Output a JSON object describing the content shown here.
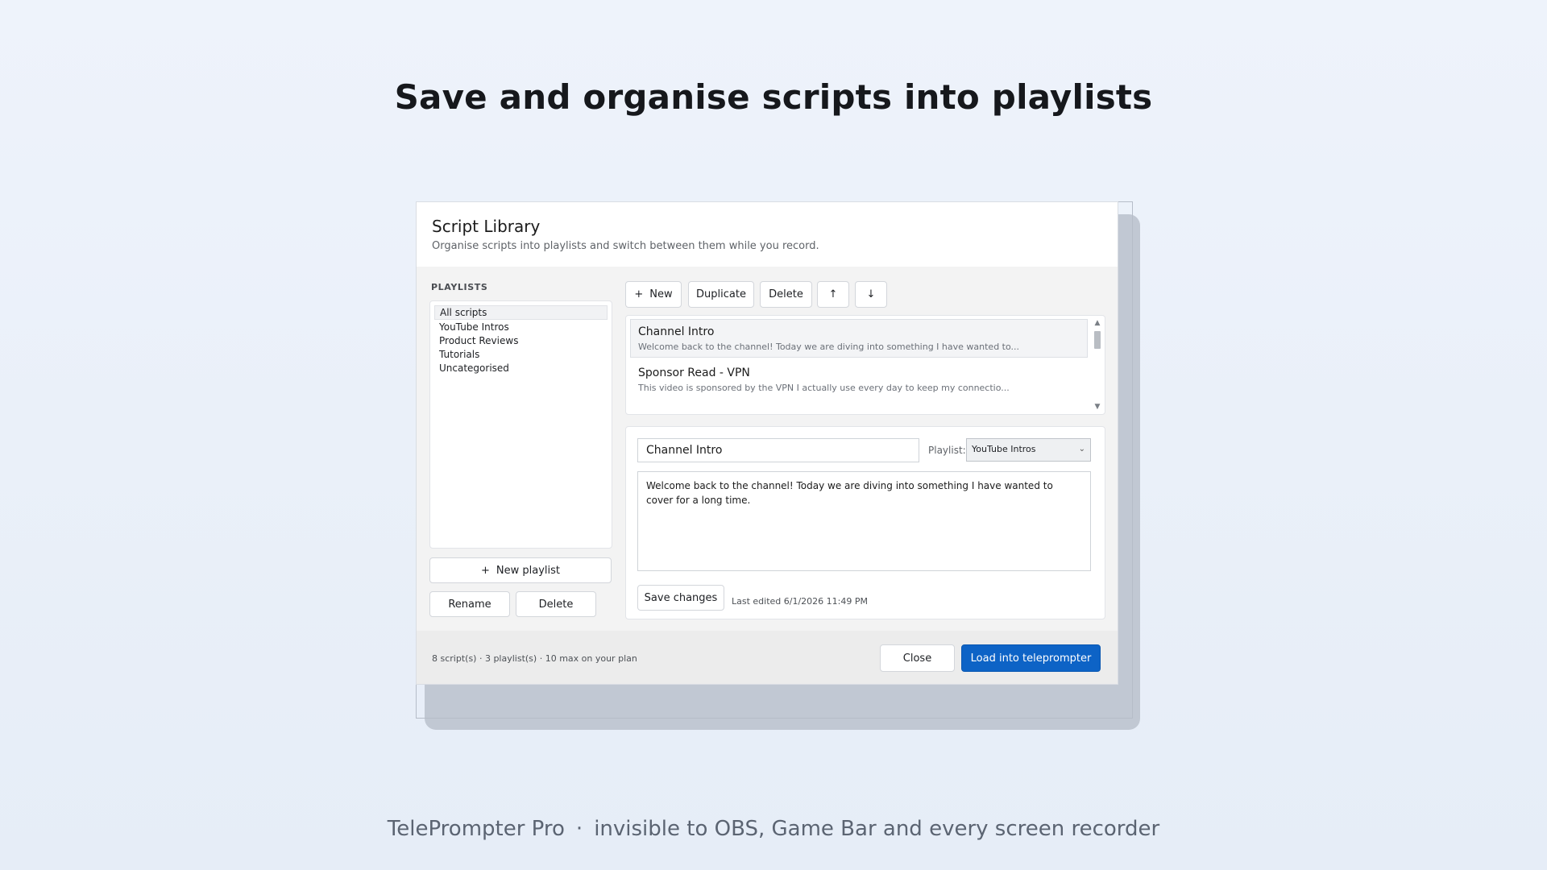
{
  "headline": "Save and organise scripts into playlists",
  "tagline": {
    "product": "TelePrompter Pro",
    "separator": "·",
    "text": "invisible to OBS, Game Bar and every screen recorder"
  },
  "window": {
    "title": "Script Library",
    "subtitle": "Organise scripts into playlists and switch between them while you record."
  },
  "playlists": {
    "heading": "PLAYLISTS",
    "items": [
      {
        "label": "All scripts",
        "selected": true
      },
      {
        "label": "YouTube Intros"
      },
      {
        "label": "Product Reviews"
      },
      {
        "label": "Tutorials"
      },
      {
        "label": "Uncategorised"
      }
    ],
    "new_label": "New playlist",
    "rename_label": "Rename",
    "delete_label": "Delete"
  },
  "toolbar": {
    "new_label": "New",
    "duplicate_label": "Duplicate",
    "delete_label": "Delete",
    "up_glyph": "↑",
    "down_glyph": "↓"
  },
  "scripts": [
    {
      "title": "Channel Intro",
      "preview": "Welcome back to the channel! Today we are diving into something I have wanted to...",
      "selected": true
    },
    {
      "title": "Sponsor Read - VPN",
      "preview": "This video is sponsored by the VPN I actually use every day to keep my connectio..."
    }
  ],
  "editor": {
    "name_value": "Channel Intro",
    "playlist_label": "Playlist:",
    "playlist_value": "YouTube Intros",
    "body_value": "Welcome back to the channel! Today we are diving into something I have wanted to cover for a long time.",
    "save_label": "Save changes",
    "last_edited": "Last edited 6/1/2026 11:49 PM"
  },
  "footer": {
    "stats": "8 script(s) · 3 playlist(s) · 10 max on your plan",
    "close_label": "Close",
    "load_label": "Load into teleprompter"
  },
  "colors": {
    "accent": "#0d63c6",
    "window_bg": "#f3f3f3",
    "panel_bg": "#ffffff"
  },
  "icons": {
    "plus": "plus-icon",
    "up": "arrow-up-icon",
    "down": "arrow-down-icon",
    "dropdown": "chevron-down-icon"
  }
}
